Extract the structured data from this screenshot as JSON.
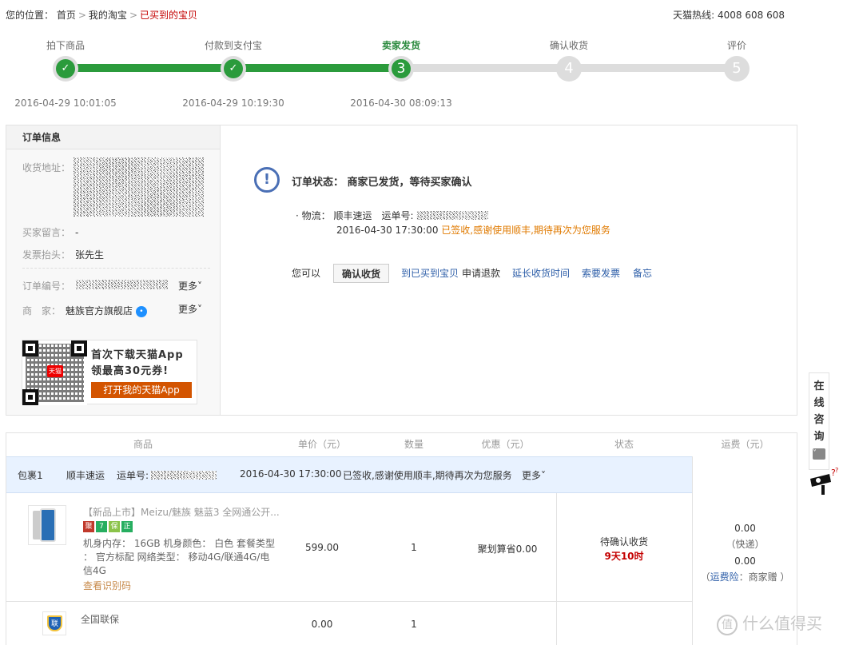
{
  "breadcrumb": {
    "prefix": "您的位置：",
    "home": "首页",
    "mytaobao": "我的淘宝",
    "current": "已买到的宝贝",
    "sep": ">"
  },
  "hotline": "天猫热线: 4008 608 608",
  "steps": [
    {
      "label": "拍下商品",
      "time": "2016-04-29 10:01:05",
      "state": "done",
      "mark": "✓"
    },
    {
      "label": "付款到支付宝",
      "time": "2016-04-29 10:19:30",
      "state": "done",
      "mark": "✓"
    },
    {
      "label": "卖家发货",
      "time": "2016-04-30 08:09:13",
      "state": "current",
      "mark": "3"
    },
    {
      "label": "确认收货",
      "time": "",
      "state": "todo",
      "mark": "4"
    },
    {
      "label": "评价",
      "time": "",
      "state": "todo",
      "mark": "5"
    }
  ],
  "order_info": {
    "title": "订单信息",
    "address_label": "收货地址：",
    "message_label": "买家留言：",
    "message_value": "-",
    "invoice_label": "发票抬头：",
    "invoice_value": "张先生",
    "order_no_label": "订单编号：",
    "more1": "更多˅",
    "shop_label": "商　家：",
    "shop_value": "魅族官方旗舰店",
    "more2": "更多˅"
  },
  "promo": {
    "line1": "首次下载天猫App",
    "line2": "领最高30元券!",
    "button": "打开我的天猫App",
    "qr_badge": "天猫"
  },
  "status": {
    "icon": "!",
    "title": "订单状态： 商家已发货，等待买家确认",
    "logistics_prefix": "· 物流： 顺丰速运　运单号:",
    "logistics_time": "2016-04-30 17:30:00",
    "logistics_msg": "已签收,感谢使用顺丰,期待再次为您服务"
  },
  "actions": {
    "prefix": "您可以",
    "confirm": "确认收货",
    "to_bought": "到已买到宝贝",
    "refund": "申请退款",
    "extend": "延长收货时间",
    "invoice": "索要发票",
    "memo": "备忘"
  },
  "table": {
    "headers": [
      "商品",
      "单价（元）",
      "数量",
      "优惠（元）",
      "状态",
      "运费（元）"
    ],
    "package": {
      "name": "包裹1",
      "carrier": "顺丰速运",
      "tracking_label": "运单号:",
      "time": "2016-04-30 17:30:00",
      "msg": "已签收,感谢使用顺丰,期待再次为您服务",
      "more": "更多˅"
    },
    "item1": {
      "title": "【新品上市】Meizu/魅族 魅蓝3 全网通公开...",
      "spec1": "机身内存： 16GB 机身颜色： 白色 套餐类型",
      "spec2": "： 官方标配 网络类型： 移动4G/联通4G/电",
      "spec3": "信4G",
      "check": "查看识别码",
      "price": "599.00",
      "qty": "1",
      "discount": "聚划算省0.00",
      "status": "待确认收货",
      "countdown": "9天10时",
      "tags": [
        "聚",
        "7",
        "保",
        "正"
      ]
    },
    "shipping": {
      "fee1": "0.00",
      "type": "（快递）",
      "fee2": "0.00",
      "insurance_open": "（",
      "insurance": "运费险",
      "insurance_rest": "：商家赠 ）"
    },
    "item2": {
      "title": "全国联保",
      "price": "0.00",
      "qty": "1",
      "icon_text": "联"
    }
  },
  "side": {
    "chars": [
      "在",
      "线",
      "咨",
      "询"
    ],
    "chev": "˅"
  },
  "watermark": "什么值得买",
  "colors": {
    "accent_green": "#2b9b3c",
    "link": "#2d5ea8",
    "orange": "#e07a00",
    "red": "#c40000"
  }
}
